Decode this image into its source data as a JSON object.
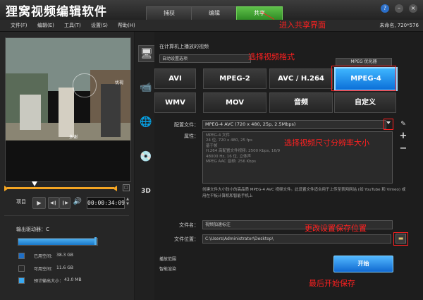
{
  "app": {
    "title": "狸窝视频编辑软件",
    "resolution_info": "未命名, 720*576"
  },
  "tabs": [
    {
      "label": "捕获"
    },
    {
      "label": "编辑"
    },
    {
      "label": "共享"
    }
  ],
  "window_buttons": {
    "help": "?",
    "minimize": "–",
    "close": "×"
  },
  "menu": [
    {
      "label": "文件(F)"
    },
    {
      "label": "编辑(E)"
    },
    {
      "label": "工具(T)"
    },
    {
      "label": "设置(S)"
    },
    {
      "label": "帮助(H)"
    }
  ],
  "preview": {
    "overlay_text": "多谢",
    "watermark": "优视"
  },
  "playback": {
    "project_label": "项目",
    "timecode": "00:00:34:09",
    "progress_fraction": 0.23
  },
  "drive": {
    "label": "输出驱动器：C",
    "used_fraction": 0.98,
    "legend": [
      {
        "label": "已用空间：",
        "value": "38.3 GB",
        "color": "#1e6fc7"
      },
      {
        "label": "可用空间：",
        "value": "11.6 GB",
        "color": "#2a2a2a"
      },
      {
        "label": "预计输出大小：",
        "value": "43.0 MB",
        "color": "#3aa9f0"
      }
    ]
  },
  "share": {
    "section_title": "在计算机上播放的视频",
    "dropdown_hint": "自动设置选项",
    "optimizer_tab": "MPEG 优化器",
    "formats": [
      {
        "label": "AVI"
      },
      {
        "label": "MPEG-2"
      },
      {
        "label": "AVC / H.264"
      },
      {
        "label": "MPEG-4"
      },
      {
        "label": "WMV"
      },
      {
        "label": "MOV"
      },
      {
        "label": "音频"
      },
      {
        "label": "自定义"
      }
    ],
    "selected_format": "MPEG-4",
    "profile_label": "配置文件：",
    "profile_value": "MPEG-4 AVC (720 x 480, 25p, 2.5Mbps)",
    "props_label": "属性：",
    "props_lines": [
      "MPEG-4 文件",
      "24 位, 720 x 480, 25 fps",
      "基于帧",
      "H.264 高配置文件视频: 2500 Kbps, 16/9",
      "48000 Hz, 16 位, 立体声",
      "MPEG AAC 音频: 256 Kbps"
    ],
    "description": "创建文件大小较小的高品质 MPEG-4 AVC 视频文件。此设置文件适合用于上传至表网网站 (如 YouTube 和 Vimeo) 或用在平板计算机和智能手机上",
    "filename_label": "文件名：",
    "filename_value": "视频加速标注",
    "location_label": "文件位置：",
    "location_value": "C:\\Users\\Administrator\\Desktop\\",
    "option1": "播放范围",
    "option2": "智能渲染",
    "start_button": "开始"
  },
  "annotations": {
    "enter_share": "进入共享界面",
    "choose_format": "选择视频格式",
    "choose_size": "选择视频尺寸分辨率大小",
    "change_location": "更改设置保存位置",
    "finally_save": "最后开始保存"
  }
}
